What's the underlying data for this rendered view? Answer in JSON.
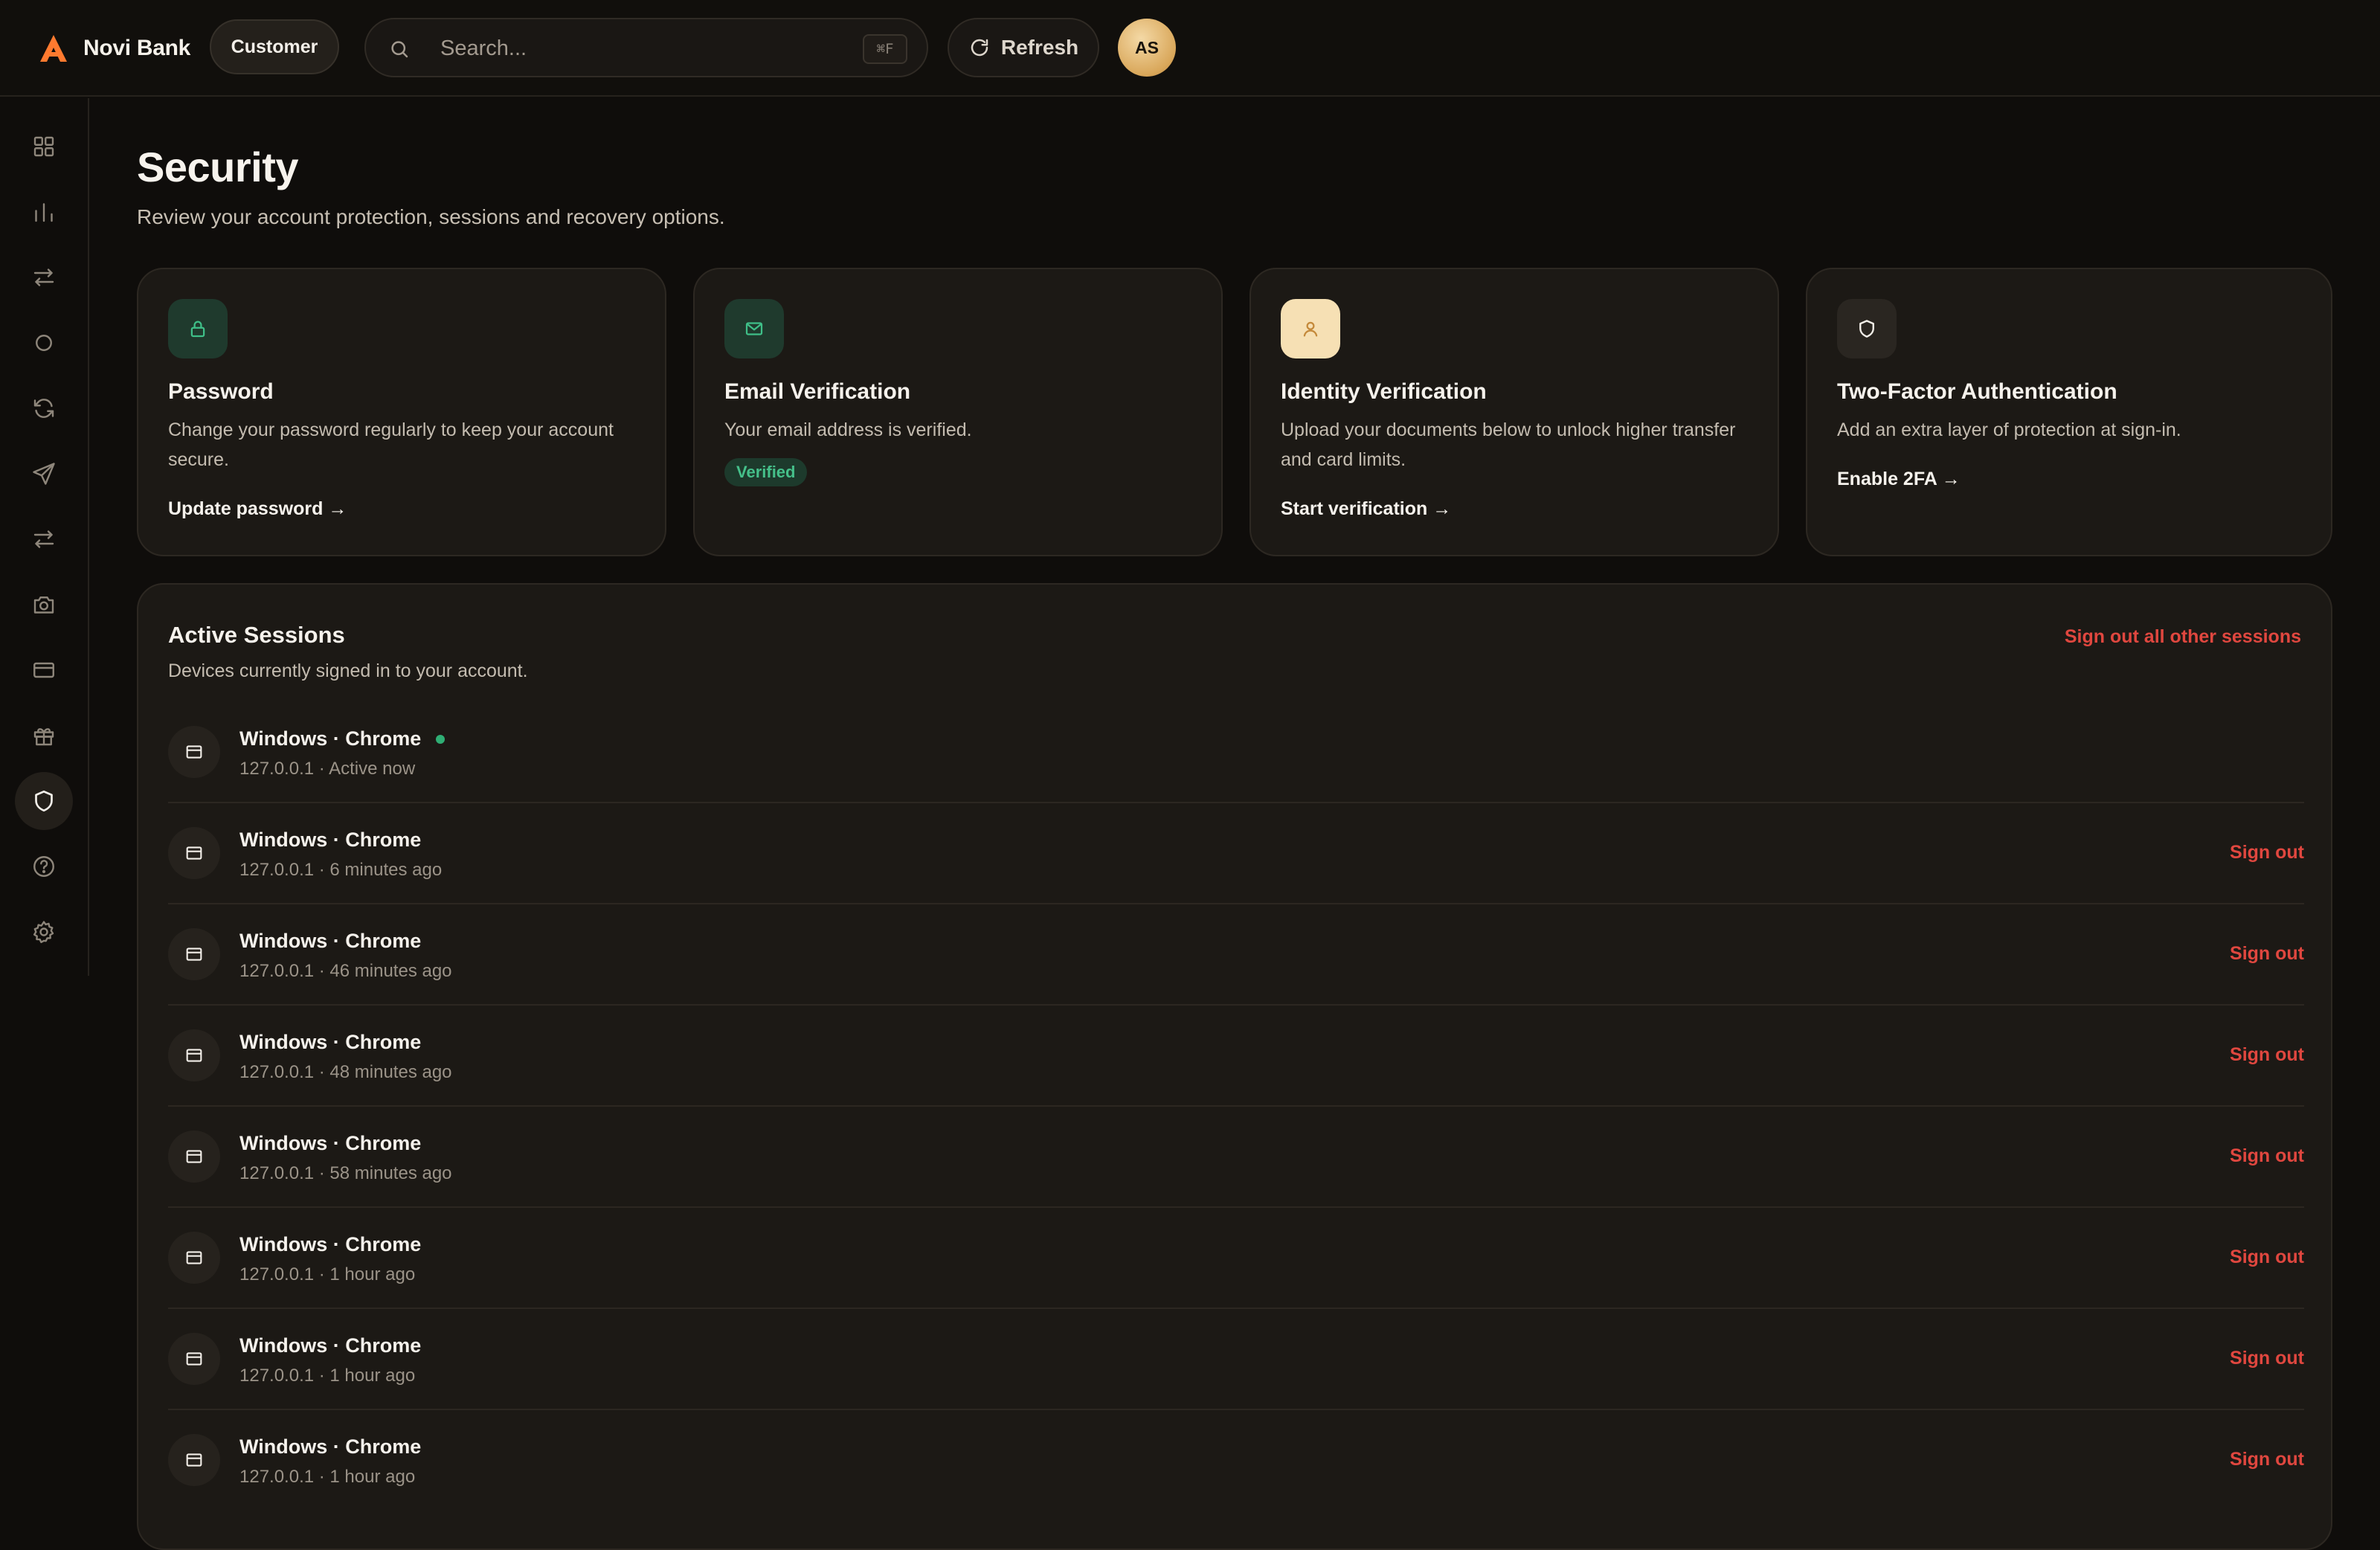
{
  "app": {
    "brand": "Novi Bank",
    "role": "Customer",
    "accent": "#ff7a2f"
  },
  "search": {
    "placeholder": "Search...",
    "value": "",
    "shortcut": "⌘F"
  },
  "header": {
    "refresh_label": "Refresh",
    "avatar_initials": "AS"
  },
  "sidebar": {
    "items": [
      {
        "name": "dashboard",
        "icon": "grid-icon"
      },
      {
        "name": "analytics",
        "icon": "bar-chart-icon"
      },
      {
        "name": "transfers",
        "icon": "swap-icon"
      },
      {
        "name": "accounts",
        "icon": "circle-icon"
      },
      {
        "name": "recurring",
        "icon": "refresh-cycle-icon"
      },
      {
        "name": "send",
        "icon": "send-icon"
      },
      {
        "name": "exchange",
        "icon": "swap-icon"
      },
      {
        "name": "documents",
        "icon": "camera-icon"
      },
      {
        "name": "cards",
        "icon": "credit-card-icon"
      },
      {
        "name": "rewards",
        "icon": "gift-icon"
      },
      {
        "name": "security",
        "icon": "shield-icon",
        "active": true
      },
      {
        "name": "help",
        "icon": "help-icon"
      },
      {
        "name": "settings",
        "icon": "gear-icon"
      }
    ]
  },
  "page": {
    "title": "Security",
    "subtitle": "Review your account protection, sessions and recovery options."
  },
  "cards": {
    "password": {
      "title": "Password",
      "description": "Change your password regularly to keep your account secure.",
      "link": "Update password →",
      "icon": "lock-icon"
    },
    "email": {
      "title": "Email Verification",
      "description": "Your email address is verified.",
      "badge": "Verified",
      "icon": "mail-icon"
    },
    "identity": {
      "title": "Identity Verification",
      "description": "Upload your documents below to unlock higher transfer and card limits.",
      "link": "Start verification →",
      "icon": "user-icon"
    },
    "twofa": {
      "title": "Two-Factor Authentication",
      "description": "Add an extra layer of protection at sign-in.",
      "link": "Enable 2FA →",
      "icon": "shield-icon"
    }
  },
  "sessions": {
    "title": "Active Sessions",
    "subtitle": "Devices currently signed in to your account.",
    "sign_out_all": "Sign out all other sessions",
    "sign_out_label": "Sign out",
    "items": [
      {
        "device": "Windows · Chrome",
        "meta": "127.0.0.1 · Active now",
        "current": true
      },
      {
        "device": "Windows · Chrome",
        "meta": "127.0.0.1 · 6 minutes ago",
        "current": false
      },
      {
        "device": "Windows · Chrome",
        "meta": "127.0.0.1 · 46 minutes ago",
        "current": false
      },
      {
        "device": "Windows · Chrome",
        "meta": "127.0.0.1 · 48 minutes ago",
        "current": false
      },
      {
        "device": "Windows · Chrome",
        "meta": "127.0.0.1 · 58 minutes ago",
        "current": false
      },
      {
        "device": "Windows · Chrome",
        "meta": "127.0.0.1 · 1 hour ago",
        "current": false
      },
      {
        "device": "Windows · Chrome",
        "meta": "127.0.0.1 · 1 hour ago",
        "current": false
      },
      {
        "device": "Windows · Chrome",
        "meta": "127.0.0.1 · 1 hour ago",
        "current": false
      }
    ]
  },
  "colors": {
    "danger": "#e0473f",
    "success": "#2fae74",
    "background": "#0f0d0b",
    "card": "#1c1915"
  }
}
